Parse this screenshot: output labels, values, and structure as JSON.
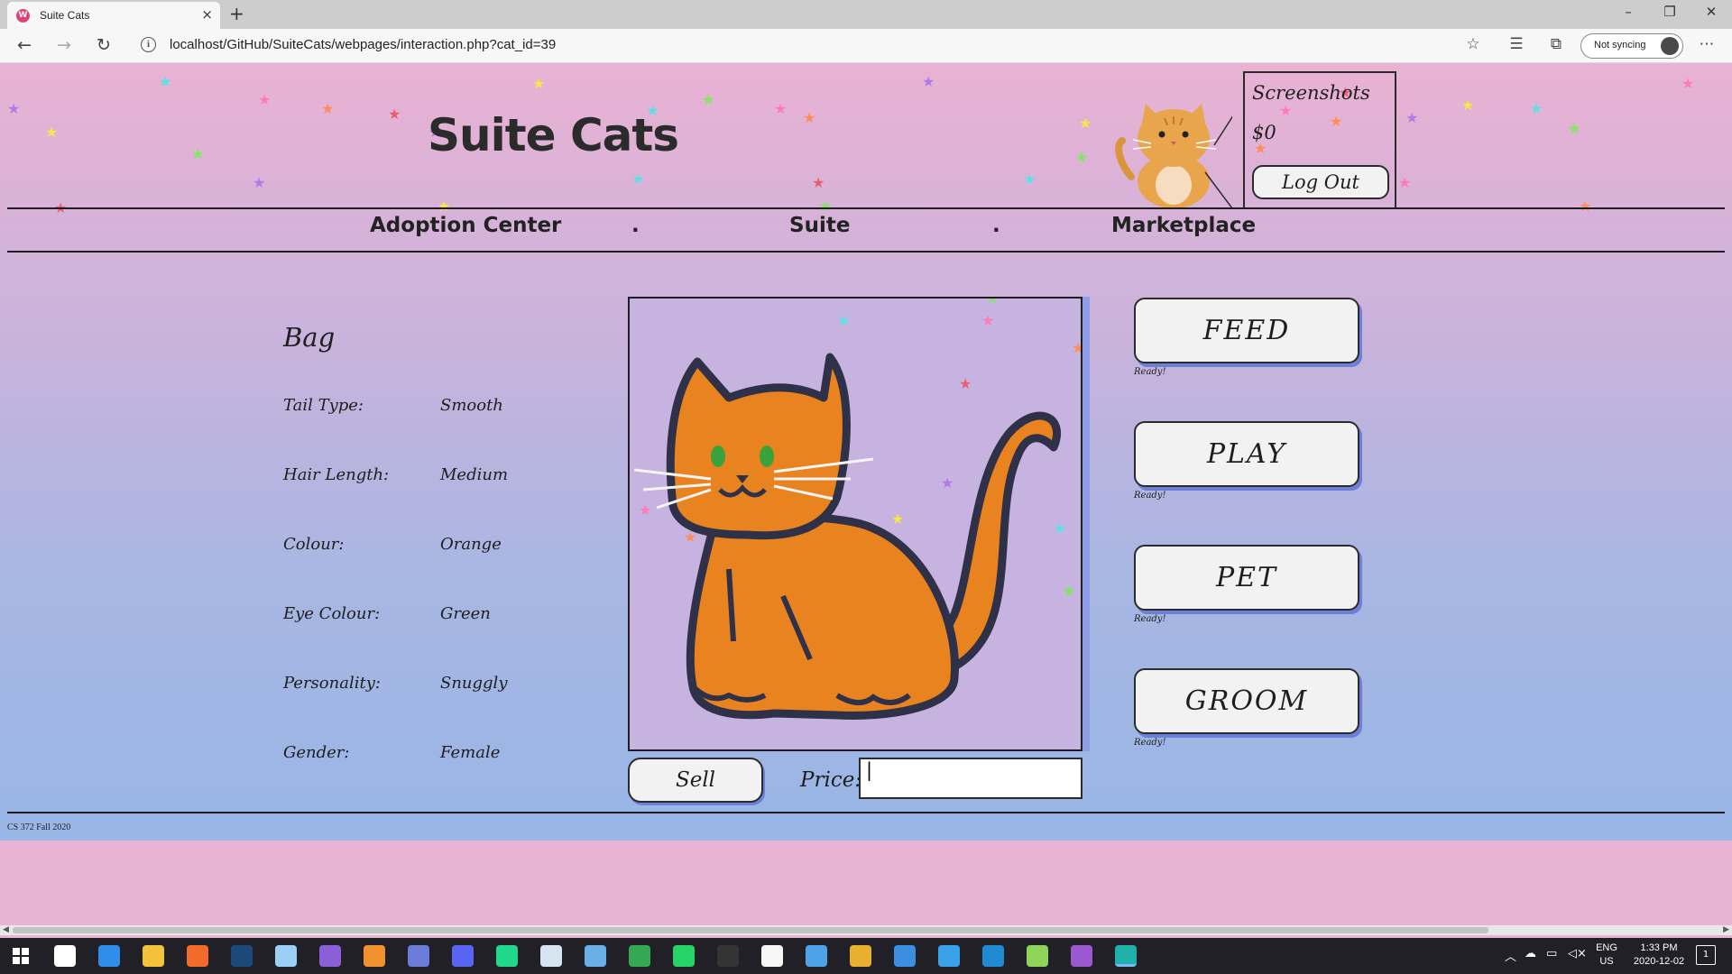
{
  "browser": {
    "tab_title": "Suite Cats",
    "tab_favicon": "W",
    "tab_close": "×",
    "new_tab": "+",
    "url": "localhost/GitHub/SuiteCats/webpages/interaction.php?cat_id=39",
    "sync_label": "Not syncing",
    "window_controls": {
      "minimize": "–",
      "restore": "❐",
      "close": "✕"
    },
    "icons": {
      "back": "back-arrow-icon",
      "forward": "forward-arrow-icon",
      "refresh": "refresh-icon",
      "info": "info-icon",
      "favorite": "star-icon",
      "favorites": "favorites-list-icon",
      "collections": "collections-icon",
      "more": "more-icon"
    }
  },
  "header": {
    "site_title": "Suite Cats",
    "profile": {
      "name": "Screenshots",
      "money": "$0",
      "logout_label": "Log Out"
    }
  },
  "nav": {
    "items": [
      "Adoption Center",
      "Suite",
      "Marketplace"
    ],
    "separator": "."
  },
  "cat": {
    "name": "Bag",
    "attributes": [
      {
        "label": "Tail Type:",
        "value": "Smooth"
      },
      {
        "label": "Hair Length:",
        "value": "Medium"
      },
      {
        "label": "Colour:",
        "value": "Orange"
      },
      {
        "label": "Eye Colour:",
        "value": "Green"
      },
      {
        "label": "Personality:",
        "value": "Snuggly"
      },
      {
        "label": "Gender:",
        "value": "Female"
      }
    ],
    "body_color": "#e8831f",
    "eye_color": "#3aa23a"
  },
  "sell": {
    "button_label": "Sell",
    "price_label": "Price:",
    "price_value": "|"
  },
  "actions": [
    {
      "label": "FEED",
      "status": "Ready!"
    },
    {
      "label": "PLAY",
      "status": "Ready!"
    },
    {
      "label": "PET",
      "status": "Ready!"
    },
    {
      "label": "GROOM",
      "status": "Ready!"
    }
  ],
  "footer": {
    "text": "CS 372 Fall 2020"
  },
  "taskbar": {
    "language": "ENG",
    "region": "US",
    "time": "1:33 PM",
    "date": "2020-12-02"
  },
  "colors": {
    "page_top": "#e9b2d3",
    "page_bottom": "#98b6e6",
    "button_shadow": "#6d7fd6"
  }
}
